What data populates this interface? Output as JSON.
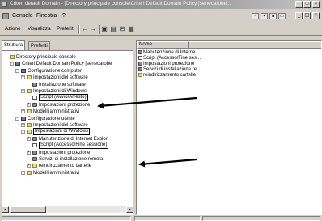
{
  "window": {
    "title": "Criteri default Domain - [Directory principale console\\Criteri Default Domain Policy [senecarobe..."
  },
  "menubar": {
    "items": [
      "Console",
      "Finestra",
      "?"
    ]
  },
  "toolbar": {
    "items": [
      "Azione",
      "Visualizza",
      "Preferiti"
    ]
  },
  "tabs": [
    "Struttura",
    "Preferiti"
  ],
  "tree": [
    {
      "label": "Directory principale console",
      "icon": "folder",
      "level": 0,
      "expander": ""
    },
    {
      "label": "Criteri Default Domain Policy [senecarobe",
      "icon": "cfg",
      "level": 1,
      "expander": "−"
    },
    {
      "label": "Configurazione computer",
      "icon": "cfg",
      "level": 2,
      "expander": "−"
    },
    {
      "label": "Impostazioni del software",
      "icon": "folder",
      "level": 3,
      "expander": "−"
    },
    {
      "label": "Installazione software",
      "icon": "gear",
      "level": 4,
      "expander": ""
    },
    {
      "label": "Impostazioni di Windows",
      "icon": "folder",
      "level": 3,
      "expander": "−"
    },
    {
      "label": "Script (Avvio/Arresto)",
      "icon": "doc",
      "level": 4,
      "expander": "",
      "boxed": true
    },
    {
      "label": "Impostazioni protezione",
      "icon": "gear",
      "level": 4,
      "expander": "+"
    },
    {
      "label": "Modelli amministrativi",
      "icon": "folder",
      "level": 3,
      "expander": "+"
    },
    {
      "label": "Configurazione utente",
      "icon": "cfg",
      "level": 2,
      "expander": "−"
    },
    {
      "label": "Impostazioni del software",
      "icon": "folder",
      "level": 3,
      "expander": "+"
    },
    {
      "label": "Impostazioni di Windows",
      "icon": "folder",
      "level": 3,
      "expander": "−",
      "boxed": true
    },
    {
      "label": "Manutenzione di Internet Explor",
      "icon": "gear",
      "level": 4,
      "expander": "+"
    },
    {
      "label": "Script (Accesso/Fine sessione)",
      "icon": "doc",
      "level": 4,
      "expander": "",
      "boxed": true
    },
    {
      "label": "Impostazioni protezione",
      "icon": "gear",
      "level": 4,
      "expander": "+"
    },
    {
      "label": "Servizi di installazione remota",
      "icon": "gear",
      "level": 4,
      "expander": ""
    },
    {
      "label": "reindirizzamento cartelle",
      "icon": "folder",
      "level": 4,
      "expander": "+"
    },
    {
      "label": "Modelli amministrativi",
      "icon": "folder",
      "level": 3,
      "expander": "+"
    }
  ],
  "list": {
    "column": "Nome",
    "items": [
      {
        "label": "Manutenzione di Interne...",
        "icon": "gear"
      },
      {
        "label": "Script (Accesso/Fine ses...",
        "icon": "doc"
      },
      {
        "label": "Impostazioni protezione",
        "icon": "gear"
      },
      {
        "label": "Servizi di installazione re...",
        "icon": "gear"
      },
      {
        "label": "reindirizzamento cartelle",
        "icon": "folder"
      }
    ]
  },
  "colors": {
    "title_gradient_start": "#6e6e6e",
    "face": "#d4d0c8",
    "arrow": "#000000"
  }
}
